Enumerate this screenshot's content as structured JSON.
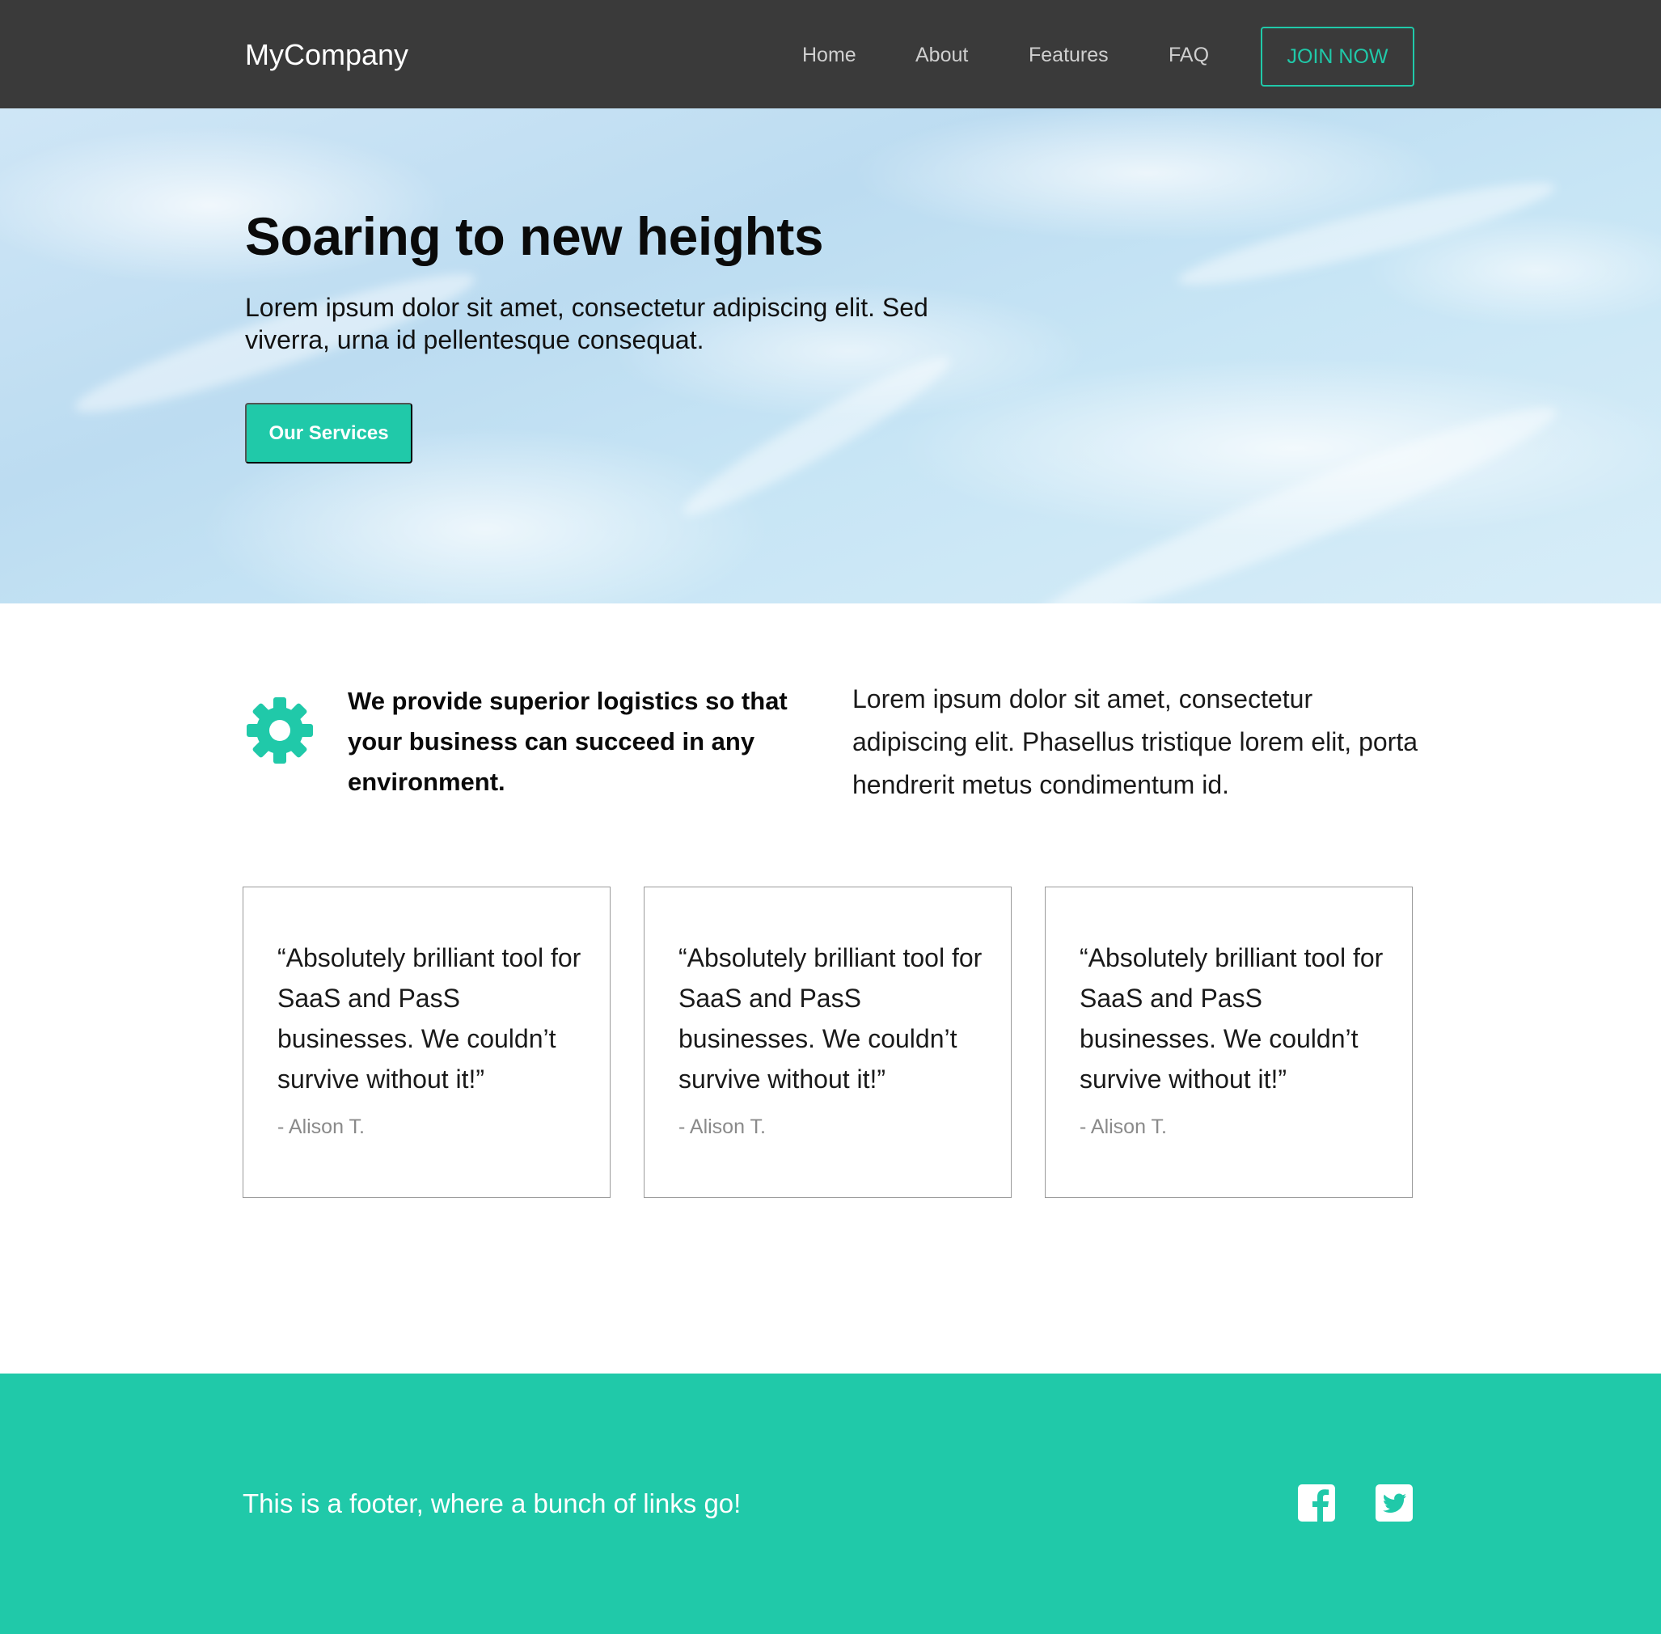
{
  "navbar": {
    "brand": "MyCompany",
    "links": [
      "Home",
      "About",
      "Features",
      "FAQ"
    ],
    "cta": "JOIN NOW"
  },
  "hero": {
    "title": "Soaring to new heights",
    "subtitle": "Lorem ipsum dolor sit amet, consectetur adipiscing elit. Sed viverra, urna id pellentesque consequat.",
    "button": "Our Services"
  },
  "feature": {
    "icon": "gear-icon",
    "heading": "We provide superior logistics so that your business can succeed in any environment.",
    "body": "Lorem ipsum dolor sit amet, consectetur adipiscing elit. Phasellus tristique lorem elit, porta hendrerit metus condimentum id."
  },
  "testimonials": [
    {
      "quote": "“Absolutely brilliant tool for SaaS and PasS businesses. We couldn’t survive without it!”",
      "author": "- Alison T."
    },
    {
      "quote": "“Absolutely brilliant tool for SaaS and PasS businesses. We couldn’t survive without it!”",
      "author": "- Alison T."
    },
    {
      "quote": "“Absolutely brilliant tool for SaaS and PasS businesses. We couldn’t survive without it!”",
      "author": "- Alison T."
    }
  ],
  "footer": {
    "text": "This is a footer, where a bunch of links go!",
    "social": [
      "facebook-icon",
      "twitter-icon"
    ]
  },
  "colors": {
    "accent": "#20c9a9",
    "navbar": "#3a3a3a",
    "footer": "#20c9a9"
  }
}
